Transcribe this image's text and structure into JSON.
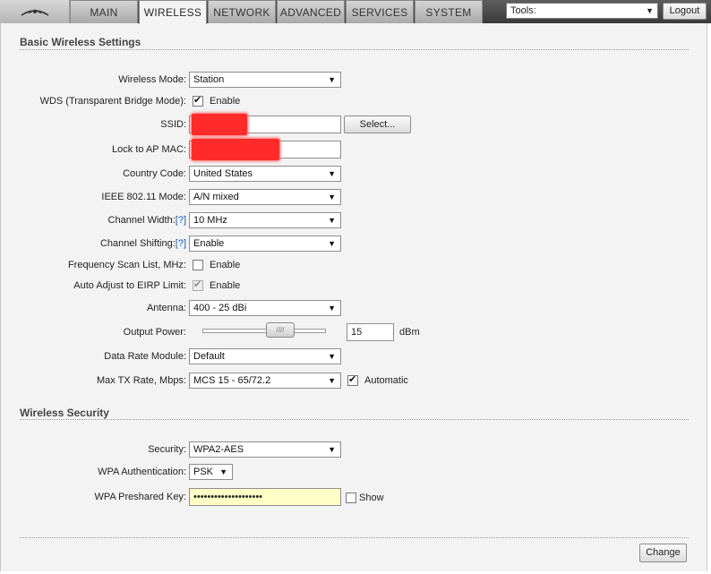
{
  "header": {
    "tabs": [
      {
        "label": "MAIN",
        "active": false
      },
      {
        "label": "WIRELESS",
        "active": true
      },
      {
        "label": "NETWORK",
        "active": false
      },
      {
        "label": "ADVANCED",
        "active": false
      },
      {
        "label": "SERVICES",
        "active": false
      },
      {
        "label": "SYSTEM",
        "active": false
      }
    ],
    "tools_value": "Tools:",
    "logout_label": "Logout"
  },
  "basic": {
    "title": "Basic Wireless Settings",
    "wireless_mode": {
      "label": "Wireless Mode:",
      "value": "Station"
    },
    "wds": {
      "label": "WDS (Transparent Bridge Mode):",
      "checked": true,
      "option": "Enable"
    },
    "ssid": {
      "label": "SSID:",
      "select_label": "Select..."
    },
    "lock_ap_mac": {
      "label": "Lock to AP MAC:"
    },
    "country_code": {
      "label": "Country Code:",
      "value": "United States"
    },
    "ieee_mode": {
      "label": "IEEE 802.11 Mode:",
      "value": "A/N mixed"
    },
    "channel_width": {
      "label": "Channel Width:",
      "help": "[?]",
      "value": "10 MHz"
    },
    "channel_shifting": {
      "label": "Channel Shifting:",
      "help": "[?]",
      "value": "Enable"
    },
    "freq_scan": {
      "label": "Frequency Scan List, MHz:",
      "checked": false,
      "option": "Enable"
    },
    "auto_eirp": {
      "label": "Auto Adjust to EIRP Limit:",
      "checked": true,
      "option": "Enable"
    },
    "antenna": {
      "label": "Antenna:",
      "value": "400 - 25 dBi"
    },
    "output_power": {
      "label": "Output Power:",
      "value": "15",
      "unit": "dBm",
      "thumb_glyph": "////"
    },
    "data_rate": {
      "label": "Data Rate Module:",
      "value": "Default"
    },
    "max_tx": {
      "label": "Max TX Rate, Mbps:",
      "value": "MCS 15 - 65/72.2",
      "auto_checked": true,
      "auto_label": "Automatic"
    }
  },
  "security": {
    "title": "Wireless Security",
    "security": {
      "label": "Security:",
      "value": "WPA2-AES"
    },
    "wpa_auth": {
      "label": "WPA Authentication:",
      "value": "PSK"
    },
    "psk": {
      "label": "WPA Preshared Key:",
      "value": "••••••••••••••••••••",
      "show_checked": false,
      "show_label": "Show"
    }
  },
  "footer": {
    "change_label": "Change"
  }
}
